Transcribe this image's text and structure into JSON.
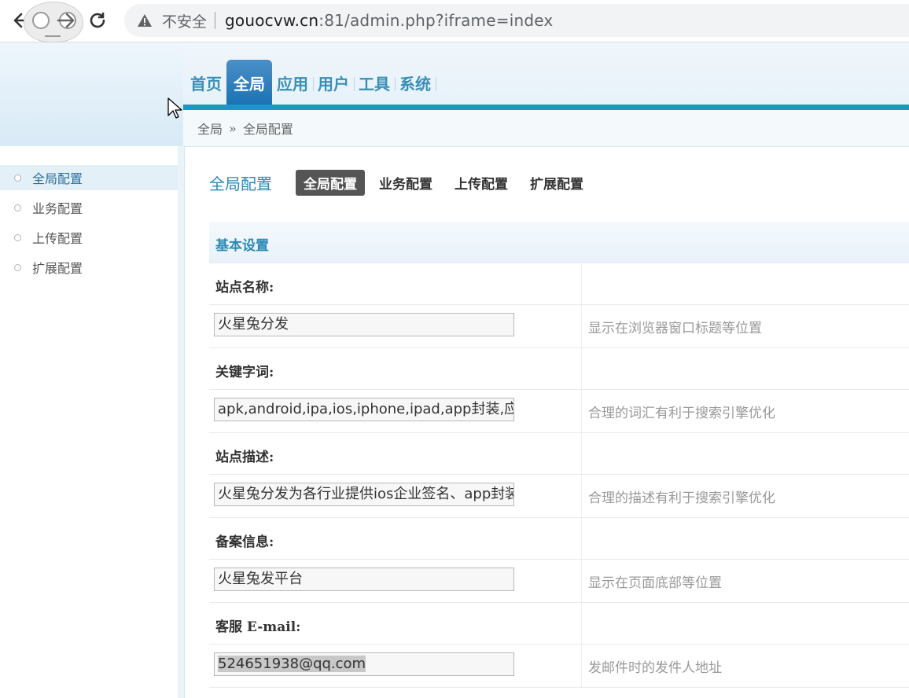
{
  "browser": {
    "security_label": "不安全",
    "url_host": "gouocvw.cn",
    "url_rest": ":81/admin.php?iframe=index"
  },
  "mainnav": {
    "items": [
      {
        "label": "首页",
        "active": false
      },
      {
        "label": "全局",
        "active": true
      },
      {
        "label": "应用",
        "active": false
      },
      {
        "label": "用户",
        "active": false
      },
      {
        "label": "工具",
        "active": false
      },
      {
        "label": "系统",
        "active": false
      }
    ]
  },
  "breadcrumb": {
    "root": "全局",
    "separator": "»",
    "current": "全局配置"
  },
  "sidebar": {
    "items": [
      {
        "label": "全局配置",
        "active": true
      },
      {
        "label": "业务配置",
        "active": false
      },
      {
        "label": "上传配置",
        "active": false
      },
      {
        "label": "扩展配置",
        "active": false
      }
    ]
  },
  "content": {
    "title": "全局配置",
    "tabs": [
      {
        "label": "全局配置",
        "active": true
      },
      {
        "label": "业务配置",
        "active": false
      },
      {
        "label": "上传配置",
        "active": false
      },
      {
        "label": "扩展配置",
        "active": false
      }
    ],
    "section_title": "基本设置",
    "fields": [
      {
        "label": "站点名称:",
        "value": "火星兔分发",
        "hint": "显示在浏览器窗口标题等位置"
      },
      {
        "label": "关键字词:",
        "value": "apk,android,ipa,ios,iphone,ipad,app封装,应",
        "hint": "合理的词汇有利于搜索引擎优化"
      },
      {
        "label": "站点描述:",
        "value": "火星兔分发为各行业提供ios企业签名、app封装",
        "hint": "合理的描述有利于搜索引擎优化"
      },
      {
        "label": "备案信息:",
        "value": "火星兔发平台",
        "hint": "显示在页面底部等位置"
      },
      {
        "label": "客服 E-mail:",
        "value": "524651938@qq.com",
        "hint": "发邮件时的发件人地址"
      }
    ]
  },
  "colors": {
    "accent": "#1d95c8",
    "nav_active": "#1a72b3",
    "tab_active": "#555555"
  }
}
